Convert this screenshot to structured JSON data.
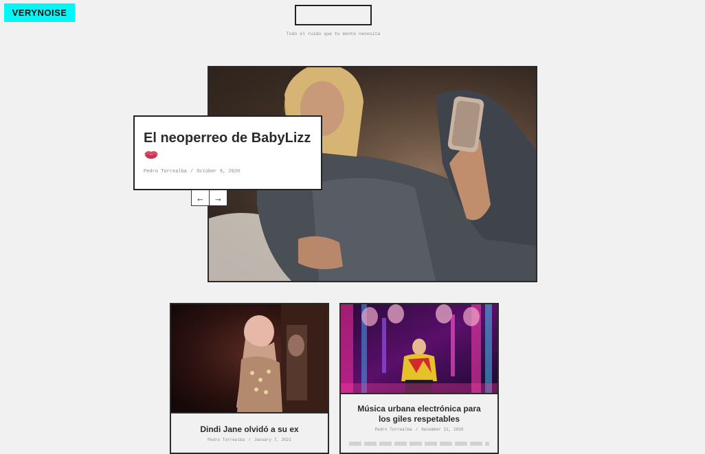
{
  "site": {
    "logo": "VERYNOISE",
    "tagline": "Todo el ruido que tu mente necesita",
    "accent_color": "#00f7f7"
  },
  "featured": {
    "title": "El neoperreo de BabyLizz",
    "emoji": "lips-icon",
    "author": "Pedro Torrealba",
    "separator": "/",
    "date": "October 9, 2020",
    "prev_icon": "arrow-left-icon",
    "next_icon": "arrow-right-icon",
    "prev_glyph": "←",
    "next_glyph": "→"
  },
  "articles": [
    {
      "title": "Dindi Jane olvidó a su ex",
      "author": "Pedro Torrealba",
      "separator": "/",
      "date": "January 7, 2021"
    },
    {
      "title": "Música urbana electrónica para los giles respetables",
      "author": "Pedro Torrealba",
      "separator": "/",
      "date": "December 21, 2020"
    }
  ]
}
